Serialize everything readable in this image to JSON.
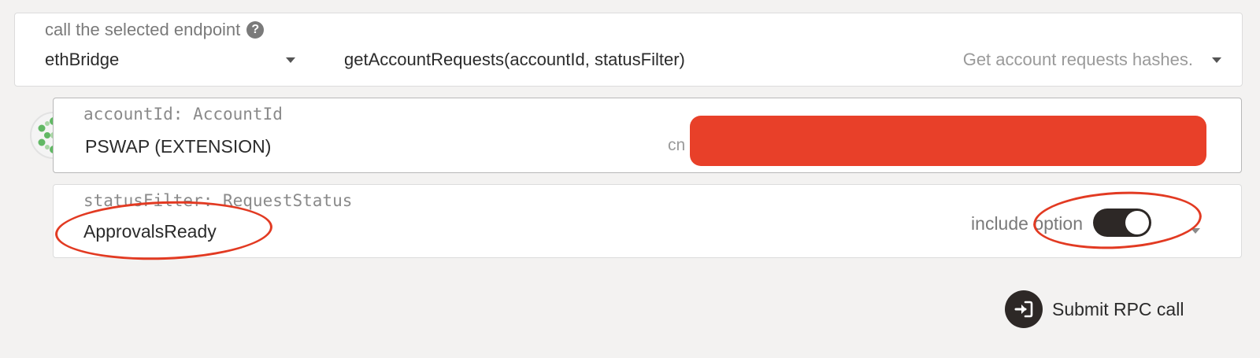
{
  "endpoint": {
    "label": "call the selected endpoint",
    "section": "ethBridge",
    "method": "getAccountRequests(accountId, statusFilter)",
    "method_description": "Get account requests hashes."
  },
  "params": [
    {
      "label": "accountId: AccountId",
      "value": "PSWAP (EXTENSION)",
      "address_prefix": "cn"
    },
    {
      "label": "statusFilter: RequestStatus",
      "value": "ApprovalsReady",
      "include_option_label": "include option",
      "include_option_enabled": true
    }
  ],
  "submit": {
    "label": "Submit RPC call"
  },
  "colors": {
    "annotation": "#e23a22",
    "redaction": "#e84029"
  },
  "icons": [
    "help-icon",
    "chevron-down-icon",
    "avatar-identicon",
    "sign-in-icon"
  ]
}
